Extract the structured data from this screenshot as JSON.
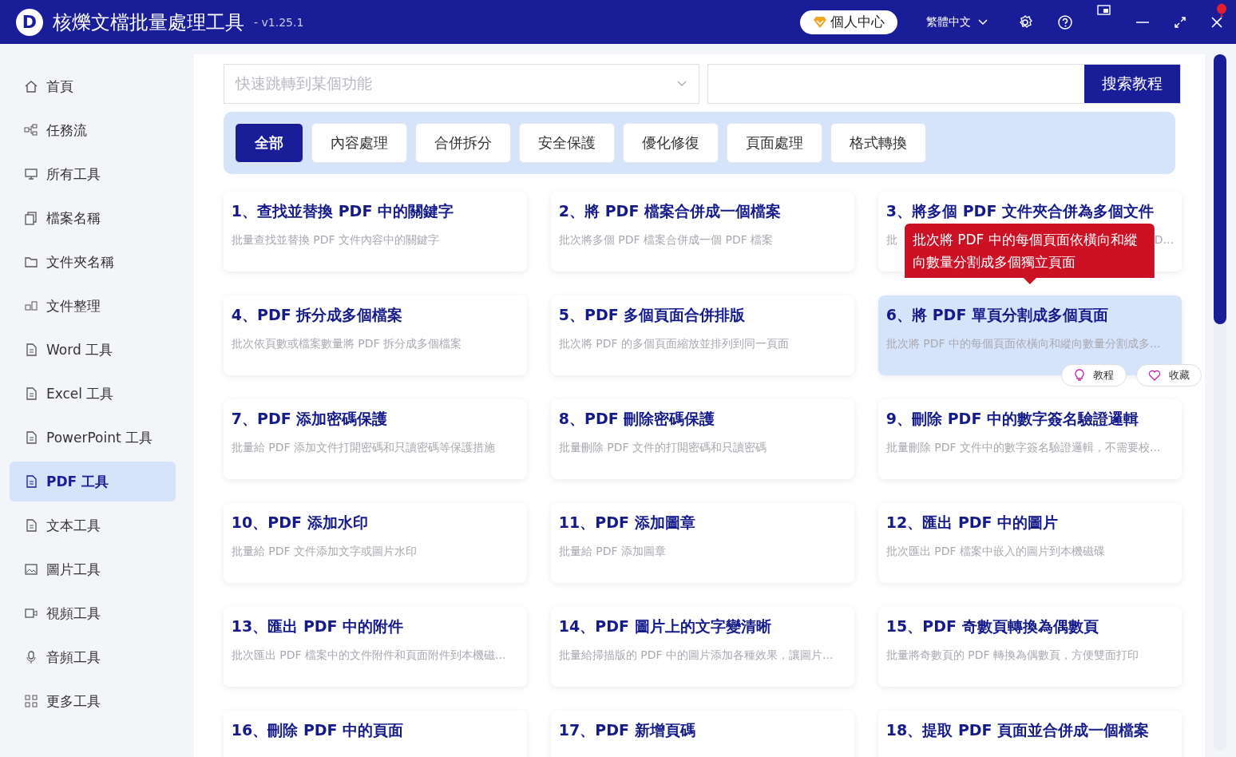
{
  "app": {
    "logo_letter": "D",
    "title": "核爍文檔批量處理工具",
    "version": "- v1.25.1",
    "user_center": "個人中心",
    "language": "繁體中文"
  },
  "sidebar": {
    "items": [
      {
        "label": "首頁",
        "selected": false
      },
      {
        "label": "任務流",
        "selected": false
      },
      {
        "label": "所有工具",
        "selected": false
      },
      {
        "label": "檔案名稱",
        "selected": false
      },
      {
        "label": "文件夾名稱",
        "selected": false
      },
      {
        "label": "文件整理",
        "selected": false
      },
      {
        "label": "Word 工具",
        "selected": false
      },
      {
        "label": "Excel 工具",
        "selected": false
      },
      {
        "label": "PowerPoint 工具",
        "selected": false
      },
      {
        "label": "PDF 工具",
        "selected": true
      },
      {
        "label": "文本工具",
        "selected": false
      },
      {
        "label": "圖片工具",
        "selected": false
      },
      {
        "label": "視頻工具",
        "selected": false
      },
      {
        "label": "音頻工具",
        "selected": false
      },
      {
        "label": "更多工具",
        "selected": false
      }
    ]
  },
  "search": {
    "placeholder": "快速跳轉到某個功能",
    "button": "搜索教程"
  },
  "tabs": [
    {
      "label": "全部",
      "selected": true
    },
    {
      "label": "內容處理",
      "selected": false
    },
    {
      "label": "合併拆分",
      "selected": false
    },
    {
      "label": "安全保護",
      "selected": false
    },
    {
      "label": "優化修復",
      "selected": false
    },
    {
      "label": "頁面處理",
      "selected": false
    },
    {
      "label": "格式轉換",
      "selected": false
    }
  ],
  "cards": [
    {
      "title": "1、查找並替換 PDF 中的關鍵字",
      "desc": "批量查找並替換 PDF 文件內容中的關鍵字",
      "selected": false
    },
    {
      "title": "2、將 PDF 檔案合併成一個檔案",
      "desc": "批次將多個 PDF 檔案合併成一個 PDF 檔案",
      "selected": false
    },
    {
      "title": "3、將多個 PDF 文件夾合併為多個文件",
      "desc": "批",
      "desc_tail": "D...",
      "selected": false
    },
    {
      "title": "4、PDF 拆分成多個檔案",
      "desc": "批次依頁數或檔案數量將 PDF 拆分成多個檔案",
      "selected": false
    },
    {
      "title": "5、PDF 多個頁面合併排版",
      "desc": "批次將 PDF 的多個頁面縮放並排列到同一頁面",
      "selected": false
    },
    {
      "title": "6、將 PDF 單頁分割成多個頁面",
      "desc": "批次將 PDF 中的每個頁面依橫向和縱向數量分割成多...",
      "selected": true,
      "tooltip": "批次將 PDF 中的每個頁面依橫向和縱向數量分割成多個獨立頁面",
      "actions": [
        "教程",
        "收藏"
      ]
    },
    {
      "title": "7、PDF 添加密碼保護",
      "desc": "批量給 PDF 添加文件打開密碼和只讀密碼等保護措施",
      "selected": false
    },
    {
      "title": "8、PDF 刪除密碼保護",
      "desc": "批量刪除 PDF 文件的打開密碼和只讀密碼",
      "selected": false
    },
    {
      "title": "9、刪除 PDF 中的數字簽名驗證邏輯",
      "desc": "批量刪除 PDF 文件中的數字簽名驗證邏輯，不需要校...",
      "selected": false
    },
    {
      "title": "10、PDF 添加水印",
      "desc": "批量給 PDF 文件添加文字或圖片水印",
      "selected": false
    },
    {
      "title": "11、PDF 添加圖章",
      "desc": "批量給 PDF 添加圖章",
      "selected": false
    },
    {
      "title": "12、匯出 PDF 中的圖片",
      "desc": "批次匯出 PDF 檔案中嵌入的圖片到本機磁碟",
      "selected": false
    },
    {
      "title": "13、匯出 PDF 中的附件",
      "desc": "批次匯出 PDF 檔案中的文件附件和頁面附件到本機磁...",
      "selected": false
    },
    {
      "title": "14、PDF 圖片上的文字變清晰",
      "desc": "批量給掃描版的 PDF 中的圖片添加各種效果，讓圖片...",
      "selected": false
    },
    {
      "title": "15、PDF 奇數頁轉換為偶數頁",
      "desc": "批量將奇數頁的 PDF 轉換為偶數頁，方便雙面打印",
      "selected": false
    },
    {
      "title": "16、刪除 PDF 中的頁面",
      "selected": false
    },
    {
      "title": "17、PDF 新增頁碼",
      "selected": false
    },
    {
      "title": "18、提取 PDF 頁面並合併成一個檔案",
      "selected": false
    }
  ]
}
